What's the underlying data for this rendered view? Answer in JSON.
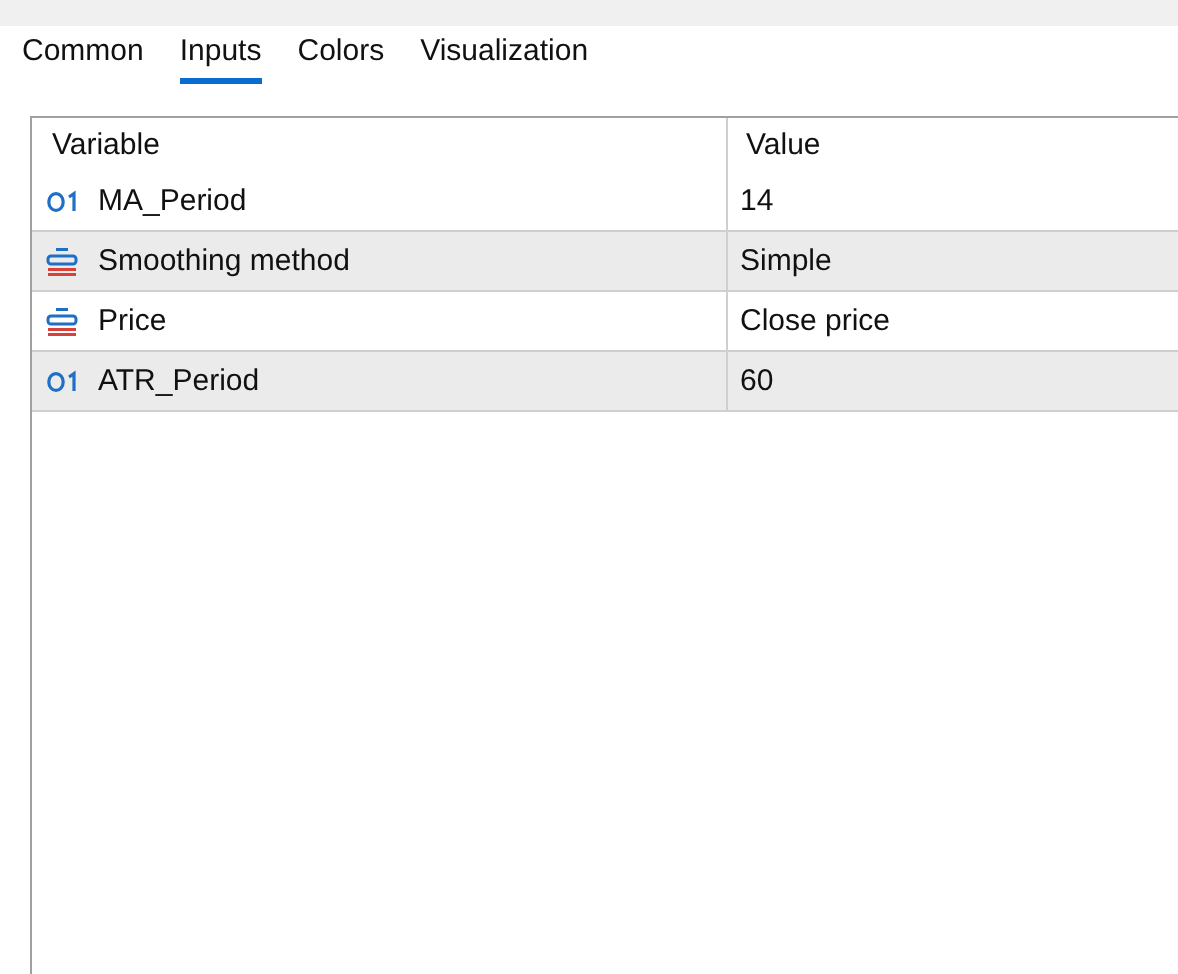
{
  "tabs": [
    {
      "label": "Common",
      "selected": false
    },
    {
      "label": "Inputs",
      "selected": true
    },
    {
      "label": "Colors",
      "selected": false
    },
    {
      "label": "Visualization",
      "selected": false
    }
  ],
  "table": {
    "columns": [
      "Variable",
      "Value"
    ],
    "rows": [
      {
        "kind": "integer",
        "variable": "MA_Period",
        "value": "14"
      },
      {
        "kind": "enum",
        "variable": "Smoothing method",
        "value": "Simple"
      },
      {
        "kind": "enum",
        "variable": "Price",
        "value": "Close price"
      },
      {
        "kind": "integer",
        "variable": "ATR_Period",
        "value": "60"
      }
    ]
  }
}
